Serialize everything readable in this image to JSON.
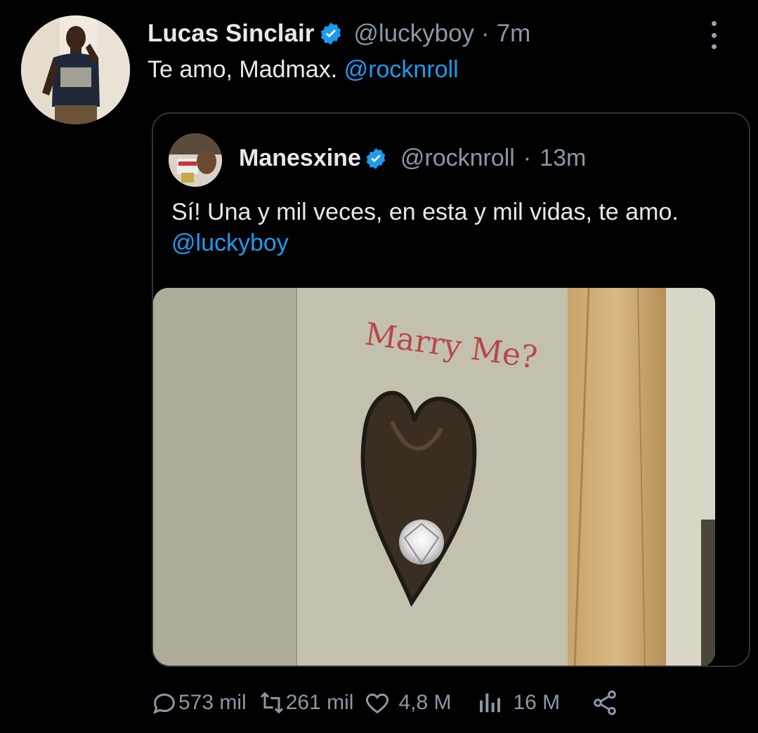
{
  "tweet": {
    "author_name": "Lucas Sinclair",
    "author_handle": "@luckyboy",
    "separator": "·",
    "time": "7m",
    "text": "Te amo, Madmax.",
    "mention": "@rocknroll"
  },
  "quoted": {
    "author_name": "Manesxine",
    "author_handle": "@rocknroll",
    "separator": "·",
    "time": "13m",
    "text": "Sí! Una y mil veces, en esta y mil vidas, te amo.",
    "mention": "@luckyboy",
    "image_text": "Marry Me?"
  },
  "actions": {
    "replies": "573 mil",
    "retweets": "261 mil",
    "likes": "4,8 M",
    "views": "16 M"
  },
  "colors": {
    "background": "#000000",
    "link": "#1d9bf0",
    "muted": "#8b98a5",
    "verified": "#1d9bf0"
  },
  "icons": [
    "verified-badge-icon",
    "more-icon",
    "reply-icon",
    "retweet-icon",
    "like-icon",
    "views-icon",
    "share-icon"
  ]
}
